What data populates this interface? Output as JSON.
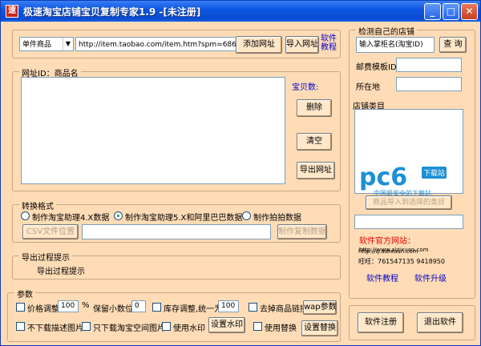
{
  "window": {
    "title": "极速淘宝店铺宝贝复制专家1.9 -[未注册]",
    "app_icon": "app-logo-icon"
  },
  "controls": {
    "minimize": "_",
    "maximize": "□",
    "close": "✕"
  },
  "url_bar": {
    "type_select": "单件商品",
    "url_value": "http://item.taobao.com/item.htm?spm=686.100092",
    "add_button": "添加网址",
    "import_button": "导入网址",
    "tutorial_link_line1": "软件",
    "tutorial_link_line2": "教程"
  },
  "list_group": {
    "title": "网址ID：商品名",
    "count_label": "宝贝数:",
    "delete_button": "删除",
    "clear_button": "清空",
    "export_button": "导出网址"
  },
  "convert_group": {
    "title": "转换格式",
    "option1": "制作淘宝助理4.X数据",
    "option2": "制作淘宝助理5.X和阿里巴巴数据",
    "option3": "制作拍拍数据",
    "csv_button": "CSV文件位置",
    "make_button": "制作复制数据"
  },
  "progress_group": {
    "title": "导出过程提示",
    "message": "导出过程提示"
  },
  "params_group": {
    "title": "参数",
    "price_adjust": "价格调整",
    "price_value": "100",
    "percent": "%",
    "decimal_label": "保留小数位",
    "decimal_value": "0",
    "stock_label": "库存调整,统一为",
    "stock_value": "100",
    "remove_links": "去掉商品链接",
    "wap_button": "wap参数",
    "no_desc_images": "不下载描述图片",
    "only_space_images": "只下载淘宝空间图片",
    "use_watermark": "使用水印",
    "watermark_button": "设置水印",
    "use_replace": "使用替换",
    "replace_button": "设置替换"
  },
  "store_group": {
    "title": "检测自己的店铺",
    "seller_input": "输入掌柜名(淘宝ID)",
    "query_button": "查 询",
    "shipping_label": "邮费模板ID",
    "location_label": "所在地",
    "category_label": "店铺类目",
    "import_category_button": "商品导入到选择的类目"
  },
  "watermark_logo": {
    "brand": "pc6",
    "badge": "下载站",
    "slogan": "中国最安全的下载站"
  },
  "info": {
    "site_label": "软件官方网站：",
    "site1": "http://www.aizixuan.com",
    "site2": "http://q.aizixuan.com",
    "wangwang": "旺旺：761547135 9418950",
    "tutorial": "软件教程",
    "upgrade": "软件升级",
    "register_button": "软件注册",
    "exit_button": "退出软件"
  }
}
